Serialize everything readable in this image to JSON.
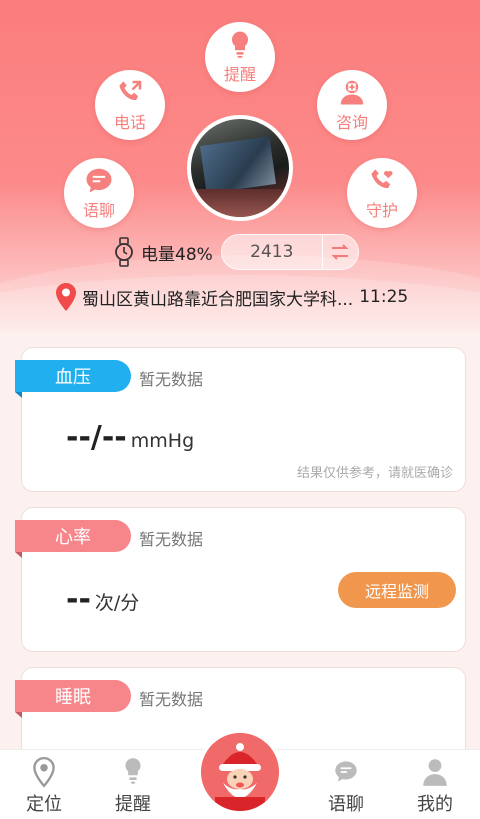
{
  "header": {
    "actions": {
      "remind": "提醒",
      "call": "电话",
      "consult": "咨询",
      "voice_chat": "语聊",
      "guard": "守护"
    },
    "battery_label": "电量48%",
    "step_count": "2413",
    "location": "蜀山区黄山路靠近合肥国家大学科...",
    "time": "11:25"
  },
  "cards": {
    "blood_pressure": {
      "title": "血压",
      "status": "暂无数据",
      "value": "--/--",
      "unit": "mmHg",
      "disclaimer": "结果仅供参考，请就医确诊"
    },
    "heart_rate": {
      "title": "心率",
      "status": "暂无数据",
      "value": "--",
      "unit": "次/分",
      "remote_button": "远程监测"
    },
    "sleep": {
      "title": "睡眠",
      "status": "暂无数据"
    }
  },
  "tabbar": {
    "locate": "定位",
    "remind": "提醒",
    "voice_chat": "语聊",
    "mine": "我的"
  },
  "colors": {
    "primary": "#f7807e",
    "bp_tag": "#21aff0",
    "hr_tag": "#f7868b",
    "remote_btn": "#f1964d"
  }
}
